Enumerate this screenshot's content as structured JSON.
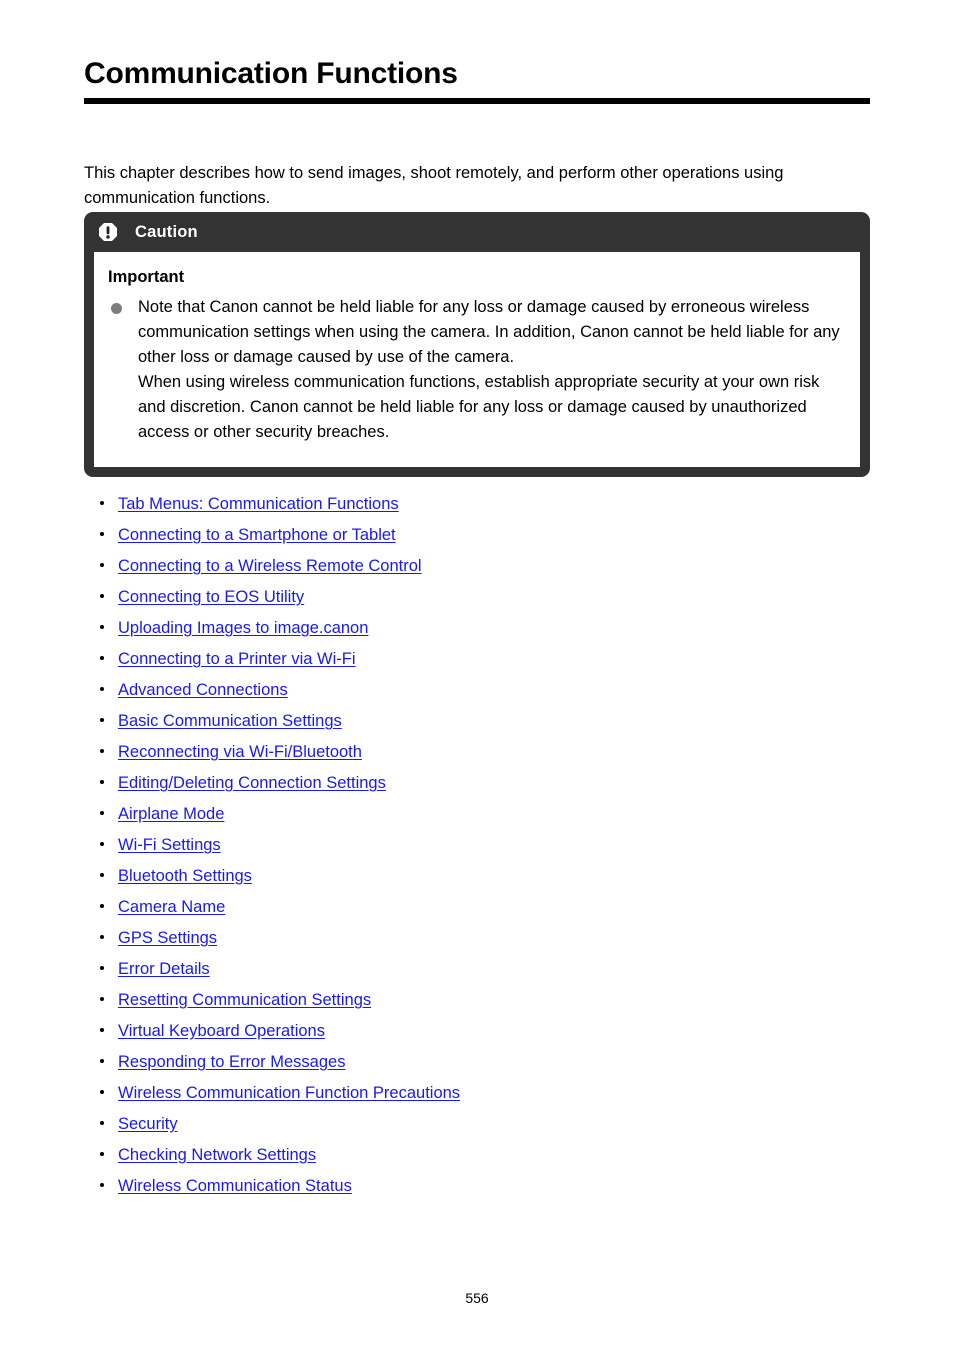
{
  "document": {
    "title": "Communication Functions",
    "intro": "This chapter describes how to send images, shoot remotely, and perform other operations using communication functions.",
    "page_number": "556"
  },
  "caution": {
    "icon": "exclamation-octagon-icon",
    "header_label": "Caution",
    "subtitle": "Important",
    "header_bg": "#333333",
    "header_text_color": "#ffffff",
    "bullet_color": "#7d7d7d",
    "items": [
      "Note that Canon cannot be held liable for any loss or damage caused by erroneous wireless communication settings when using the camera. In addition, Canon cannot be held liable for any other loss or damage caused by use of the camera.",
      "When using wireless communication functions, establish appropriate security at your own risk and discretion. Canon cannot be held liable for any loss or damage caused by unauthorized access or other security breaches."
    ]
  },
  "links": {
    "color": "#1a1ae8",
    "items": [
      {
        "label": "Tab Menus: Communication Functions"
      },
      {
        "label": "Connecting to a Smartphone or Tablet"
      },
      {
        "label": "Connecting to a Wireless Remote Control"
      },
      {
        "label": "Connecting to EOS Utility"
      },
      {
        "label": "Uploading Images to image.canon"
      },
      {
        "label": "Connecting to a Printer via Wi-Fi"
      },
      {
        "label": "Advanced Connections"
      },
      {
        "label": "Basic Communication Settings"
      },
      {
        "label": "Reconnecting via Wi-Fi/Bluetooth"
      },
      {
        "label": "Editing/Deleting Connection Settings"
      },
      {
        "label": "Airplane Mode"
      },
      {
        "label": "Wi-Fi Settings"
      },
      {
        "label": "Bluetooth Settings"
      },
      {
        "label": "Camera Name"
      },
      {
        "label": "GPS Settings"
      },
      {
        "label": "Error Details"
      },
      {
        "label": "Resetting Communication Settings"
      },
      {
        "label": "Virtual Keyboard Operations"
      },
      {
        "label": "Responding to Error Messages"
      },
      {
        "label": "Wireless Communication Function Precautions"
      },
      {
        "label": "Security"
      },
      {
        "label": "Checking Network Settings"
      },
      {
        "label": "Wireless Communication Status"
      }
    ]
  }
}
